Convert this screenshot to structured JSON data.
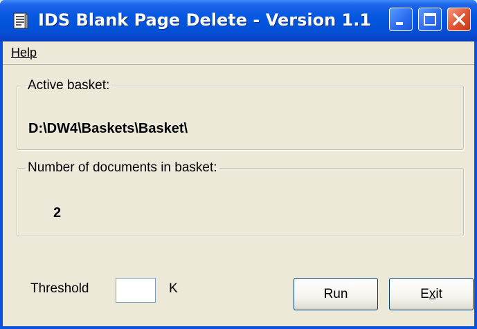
{
  "window": {
    "title": "IDS Blank Page Delete - Version 1.1",
    "accent_color": "#0558e0",
    "close_color": "#e0522e"
  },
  "title_buttons": {
    "minimize_icon": "minimize-icon",
    "maximize_icon": "maximize-icon",
    "close_icon": "close-icon"
  },
  "menu": {
    "items": [
      {
        "label": "Help",
        "mnemonic": "H"
      }
    ]
  },
  "active_basket": {
    "label": "Active basket:",
    "value": "D:\\DW4\\Baskets\\Basket\\"
  },
  "document_count": {
    "label": "Number of documents in basket:",
    "value": "2"
  },
  "threshold": {
    "label": "Threshold",
    "value": "",
    "unit": "K"
  },
  "buttons": {
    "run": {
      "label": "Run",
      "mnemonic": "R"
    },
    "exit": {
      "label_pre": "E",
      "label_mnemonic": "x",
      "label_post": "it"
    }
  }
}
